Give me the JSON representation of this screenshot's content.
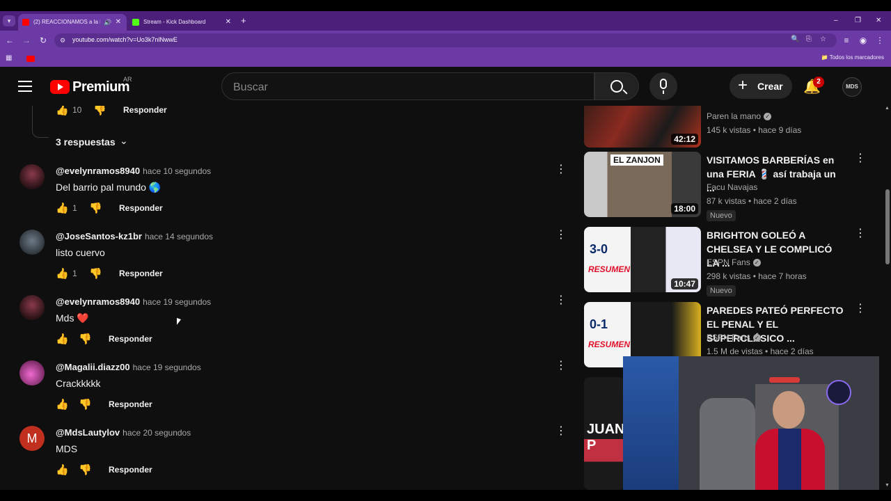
{
  "browser": {
    "tabs": [
      {
        "title": "(2) REACCIONAMOS a la HI",
        "active": true
      },
      {
        "title": "Stream - Kick Dashboard",
        "active": false
      }
    ],
    "new_tab": "+",
    "url": "youtube.com/watch?v=Uo3k7nlNwwE",
    "bookmarks_all": "Todos los marcadores",
    "window_controls": [
      "–",
      "❐",
      "✕"
    ]
  },
  "header": {
    "logo_text": "Premium",
    "region": "AR",
    "search_placeholder": "Buscar",
    "create_label": "Crear",
    "notifications_count": "2",
    "avatar_text": "MDS"
  },
  "comments": {
    "prev_likes": "10",
    "reply_label": "Responder",
    "replies_toggle": "3 respuestas",
    "items": [
      {
        "author": "@evelynramos8940",
        "time": "hace 10 segundos",
        "text": "Del barrio pal mundo 🌎",
        "likes": "1"
      },
      {
        "author": "@JoseSantos-kz1br",
        "time": "hace 14 segundos",
        "text": "listo cuervo",
        "likes": "1"
      },
      {
        "author": "@evelynramos8940",
        "time": "hace 19 segundos",
        "text": "Mds ❤️",
        "likes": ""
      },
      {
        "author": "@Magalii.diazz00",
        "time": "hace 19 segundos",
        "text": "Crackkkkk",
        "likes": ""
      },
      {
        "author": "@MdsLautylov",
        "time": "hace 20 segundos",
        "text": "MDS",
        "likes": "",
        "avatar_letter": "M"
      }
    ]
  },
  "sidebar": {
    "videos": [
      {
        "title": "",
        "channel": "Paren la mano",
        "meta": "145 k vistas • hace 9 días",
        "duration": "42:12",
        "badge": ""
      },
      {
        "title": "VISITAMOS BARBERÍAS en una FERIA 💈 así trabaja un ...",
        "channel": "Facu Navajas",
        "meta": "87 k vistas • hace 2 días",
        "duration": "18:00",
        "badge": "Nuevo",
        "thumb_text": "EL ZANJON"
      },
      {
        "title": "BRIGHTON GOLEÓ A CHELSEA Y LE COMPLICÓ LA ...",
        "channel": "ESPN Fans",
        "meta": "298 k vistas • hace 7 horas",
        "duration": "10:47",
        "badge": "Nuevo",
        "thumb_text": "3-0",
        "thumb_sub": "RESUMEN"
      },
      {
        "title": "PAREDES PATEÓ PERFECTO EL PENAL Y EL SUPERCLÁSICO ...",
        "channel": "ESPN Fans",
        "meta": "1.5 M de vistas • hace 2 días",
        "duration": "",
        "badge": "",
        "thumb_text": "0-1",
        "thumb_sub": "RESUMEN"
      },
      {
        "title": "",
        "channel": "",
        "meta": "",
        "duration": "",
        "badge": "",
        "thumb_text": "JUAN P"
      }
    ]
  },
  "colors": {
    "browser_purple": "#6b3aa5",
    "youtube_red": "#ff0000",
    "background": "#0f0f0f"
  }
}
